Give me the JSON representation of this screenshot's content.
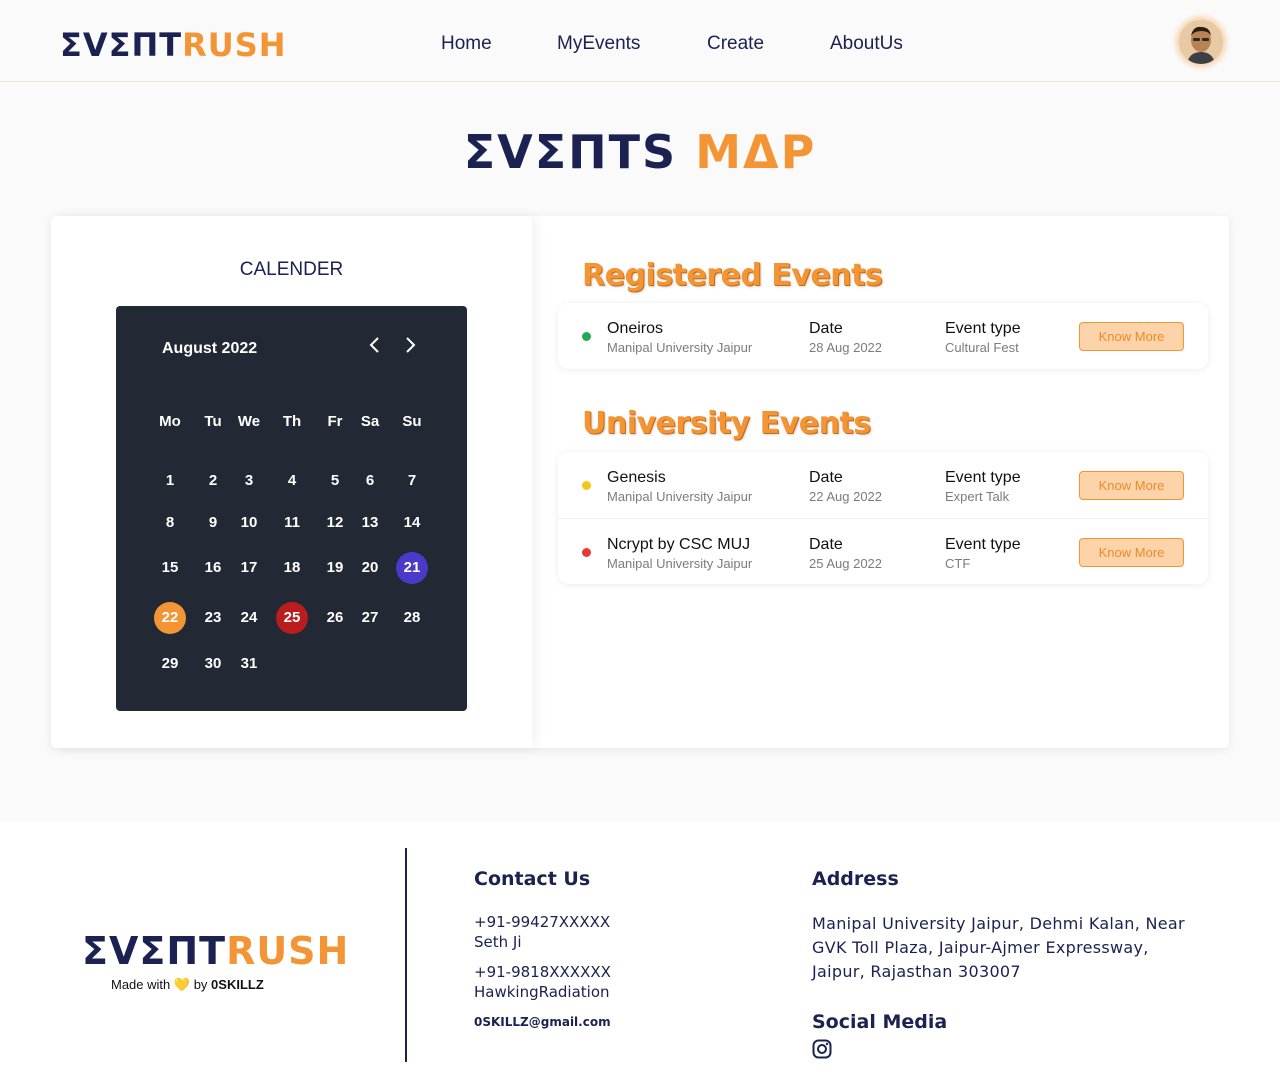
{
  "header": {
    "logo_part1": "ΣVΣПT",
    "logo_part2": "RUSH",
    "nav": [
      "Home",
      "MyEvents",
      "Create",
      "AboutUs"
    ]
  },
  "page_title": {
    "part1": "ΣVΣПTS",
    "part2": "MΔP"
  },
  "calendar": {
    "heading": "CALENDER",
    "month": "August 2022",
    "prev": "‹",
    "next": "›",
    "weekdays": [
      "Mo",
      "Tu",
      "We",
      "Th",
      "Fr",
      "Sa",
      "Su"
    ],
    "weeks": [
      [
        "1",
        "2",
        "3",
        "4",
        "5",
        "6",
        "7"
      ],
      [
        "8",
        "9",
        "10",
        "11",
        "12",
        "13",
        "14"
      ],
      [
        "15",
        "16",
        "17",
        "18",
        "19",
        "20",
        "21"
      ],
      [
        "22",
        "23",
        "24",
        "25",
        "26",
        "27",
        "28"
      ],
      [
        "29",
        "30",
        "31"
      ]
    ],
    "highlights": {
      "21": "#4a3ac7",
      "22": "#f49535",
      "25": "#b91d1d"
    }
  },
  "registered": {
    "title": "Registered Events",
    "events": [
      {
        "name": "Oneiros",
        "place": "Manipal University Jaipur",
        "date_label": "Date",
        "date": "28 Aug 2022",
        "type_label": "Event type",
        "type": "Cultural Fest",
        "button": "Know More",
        "dot_color": "#1faa53"
      }
    ]
  },
  "university": {
    "title": "University Events",
    "events": [
      {
        "name": "Genesis",
        "place": "Manipal University Jaipur",
        "date_label": "Date",
        "date": "22 Aug 2022",
        "type_label": "Event type",
        "type": "Expert Talk",
        "button": "Know More",
        "dot_color": "#f5c518"
      },
      {
        "name": "Ncrypt by CSC MUJ",
        "place": "Manipal University Jaipur",
        "date_label": "Date",
        "date": "25 Aug 2022",
        "type_label": "Event type",
        "type": "CTF",
        "button": "Know More",
        "dot_color": "#e53935"
      }
    ]
  },
  "footer": {
    "logo_part1": "ΣVΣПT",
    "logo_part2": "RUSH",
    "made_prefix": "Made with",
    "made_heart": "💛",
    "made_by": "by",
    "made_author": "0SKILLZ",
    "contact_title": "Contact Us",
    "phone1": "+91-99427XXXXX",
    "name1": "Seth Ji",
    "phone2": "+91-9818XXXXXX",
    "name2": "HawkingRadiation",
    "email": "0SKILLZ@gmail.com",
    "address_title": "Address",
    "address": "Manipal University Jaipur, Dehmi Kalan, Near GVK Toll Plaza, Jaipur-Ajmer Expressway, Jaipur, Rajasthan 303007",
    "social_title": "Social Media",
    "social_icon": "instagram-icon"
  },
  "colors": {
    "navy": "#1b2150",
    "orange": "#f49535",
    "calendar_bg": "#222935"
  }
}
